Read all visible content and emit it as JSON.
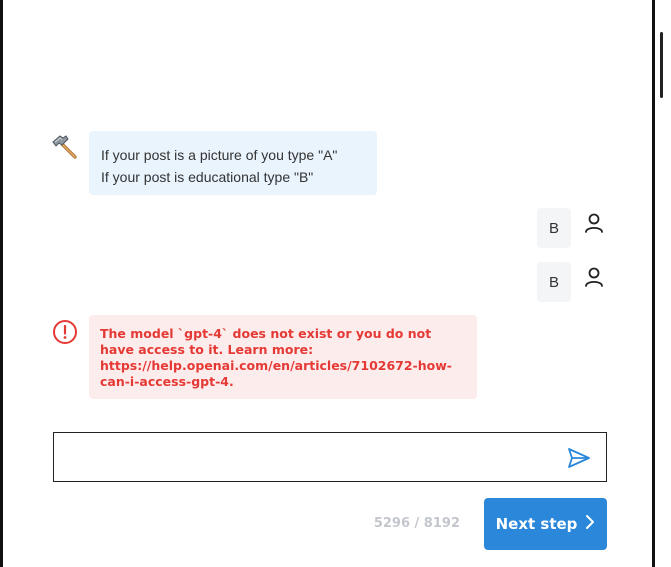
{
  "chat": {
    "bot_message": {
      "lines": [
        "If your post is a picture of you type \"A\"",
        "If your post is educational type \"B\""
      ],
      "icon": "hammer-icon"
    },
    "user_messages": [
      {
        "text": "B",
        "icon": "user-icon"
      },
      {
        "text": "B",
        "icon": "user-icon"
      }
    ],
    "error_message": {
      "text": "The model `gpt-4` does not exist or you do not have access to it. Learn more: https://help.openai.com/en/articles/7102672-how-can-i-access-gpt-4.",
      "icon": "alert-circle-icon",
      "color": "#e53935"
    }
  },
  "composer": {
    "value": "",
    "placeholder": "",
    "send_icon": "send-icon"
  },
  "footer": {
    "token_counter": "5296 / 8192",
    "next_label": "Next step",
    "next_icon": "chevron-right-icon"
  },
  "colors": {
    "accent": "#2a87d9",
    "bot_bubble": "#e9f4fd",
    "error_bubble": "#fdecec",
    "user_bubble": "#f4f5f7"
  }
}
